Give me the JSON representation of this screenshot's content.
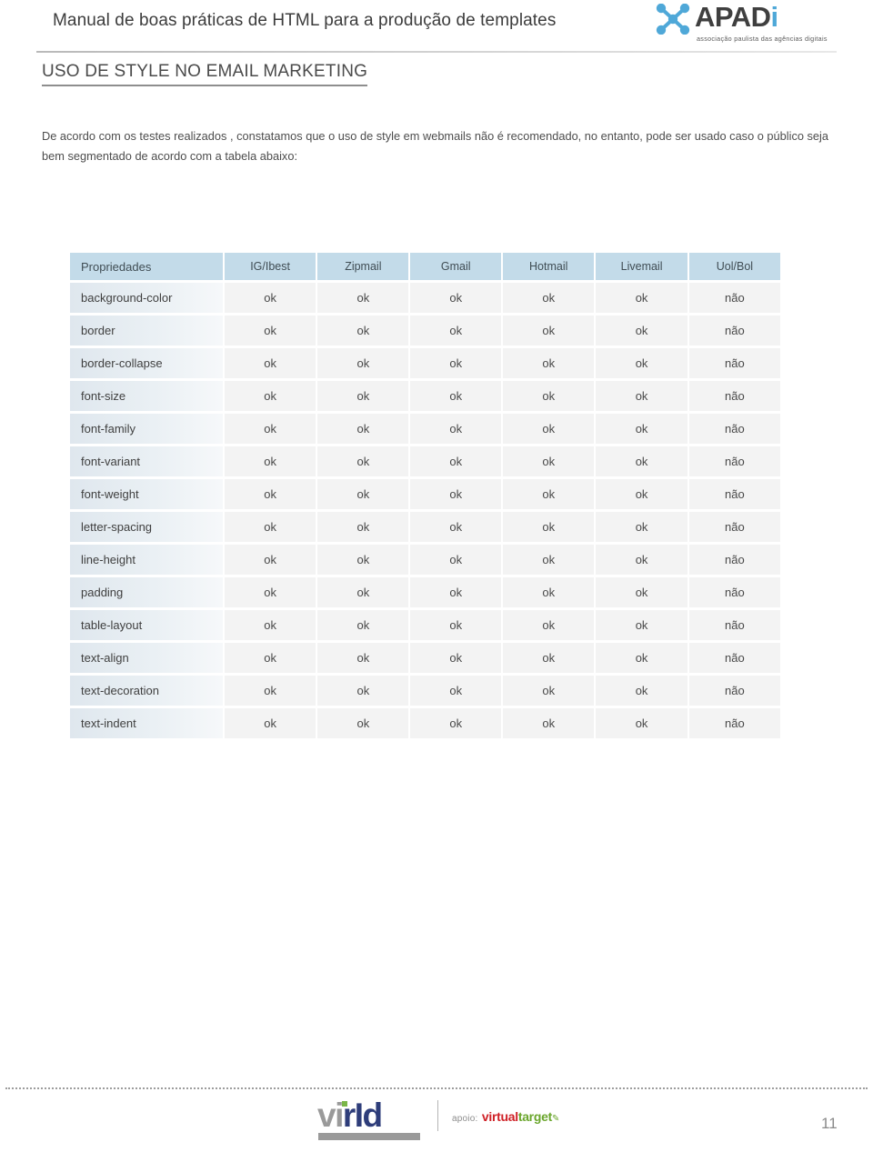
{
  "header": {
    "document_title": "Manual de boas práticas de HTML para a produção de templates",
    "brand": {
      "wordmark_main": "APAD",
      "wordmark_accent": "i",
      "tagline": "associação paulista das agências digitais",
      "mark_icon": "x-nodes-icon",
      "accent_color": "#4fa8d8"
    }
  },
  "section": {
    "title": "USO DE STYLE NO EMAIL MARKETING",
    "intro": "De acordo com os testes realizados , constatamos que o uso de style em webmails não é recomendado, no entanto, pode ser usado caso o público seja bem segmentado de acordo com a tabela abaixo:"
  },
  "table": {
    "header_bg": "#c3dbe9",
    "ok_color": "#4a9b4a",
    "nao_color": "#a8253f",
    "columns": [
      "Propriedades",
      "IG/Ibest",
      "Zipmail",
      "Gmail",
      "Hotmail",
      "Livemail",
      "Uol/Bol"
    ],
    "rows": [
      {
        "property": "background-color",
        "values": [
          "ok",
          "ok",
          "ok",
          "ok",
          "ok",
          "não"
        ]
      },
      {
        "property": "border",
        "values": [
          "ok",
          "ok",
          "ok",
          "ok",
          "ok",
          "não"
        ]
      },
      {
        "property": "border-collapse",
        "values": [
          "ok",
          "ok",
          "ok",
          "ok",
          "ok",
          "não"
        ]
      },
      {
        "property": "font-size",
        "values": [
          "ok",
          "ok",
          "ok",
          "ok",
          "ok",
          "não"
        ]
      },
      {
        "property": "font-family",
        "values": [
          "ok",
          "ok",
          "ok",
          "ok",
          "ok",
          "não"
        ]
      },
      {
        "property": "font-variant",
        "values": [
          "ok",
          "ok",
          "ok",
          "ok",
          "ok",
          "não"
        ]
      },
      {
        "property": "font-weight",
        "values": [
          "ok",
          "ok",
          "ok",
          "ok",
          "ok",
          "não"
        ]
      },
      {
        "property": "letter-spacing",
        "values": [
          "ok",
          "ok",
          "ok",
          "ok",
          "ok",
          "não"
        ]
      },
      {
        "property": "line-height",
        "values": [
          "ok",
          "ok",
          "ok",
          "ok",
          "ok",
          "não"
        ]
      },
      {
        "property": "padding",
        "values": [
          "ok",
          "ok",
          "ok",
          "ok",
          "ok",
          "não"
        ]
      },
      {
        "property": "table-layout",
        "values": [
          "ok",
          "ok",
          "ok",
          "ok",
          "ok",
          "não"
        ]
      },
      {
        "property": "text-align",
        "values": [
          "ok",
          "ok",
          "ok",
          "ok",
          "ok",
          "não"
        ]
      },
      {
        "property": "text-decoration",
        "values": [
          "ok",
          "ok",
          "ok",
          "ok",
          "ok",
          "não"
        ]
      },
      {
        "property": "text-indent",
        "values": [
          "ok",
          "ok",
          "ok",
          "ok",
          "ok",
          "não"
        ]
      }
    ]
  },
  "footer": {
    "virid": {
      "part_grey": "vi",
      "part_blue": "rId",
      "dot_color": "#7ab648"
    },
    "virtual_target": {
      "apoio_label": "apoio:",
      "virtual": "virtual",
      "target": "target",
      "swoosh": "✎"
    },
    "page_number": "11"
  }
}
